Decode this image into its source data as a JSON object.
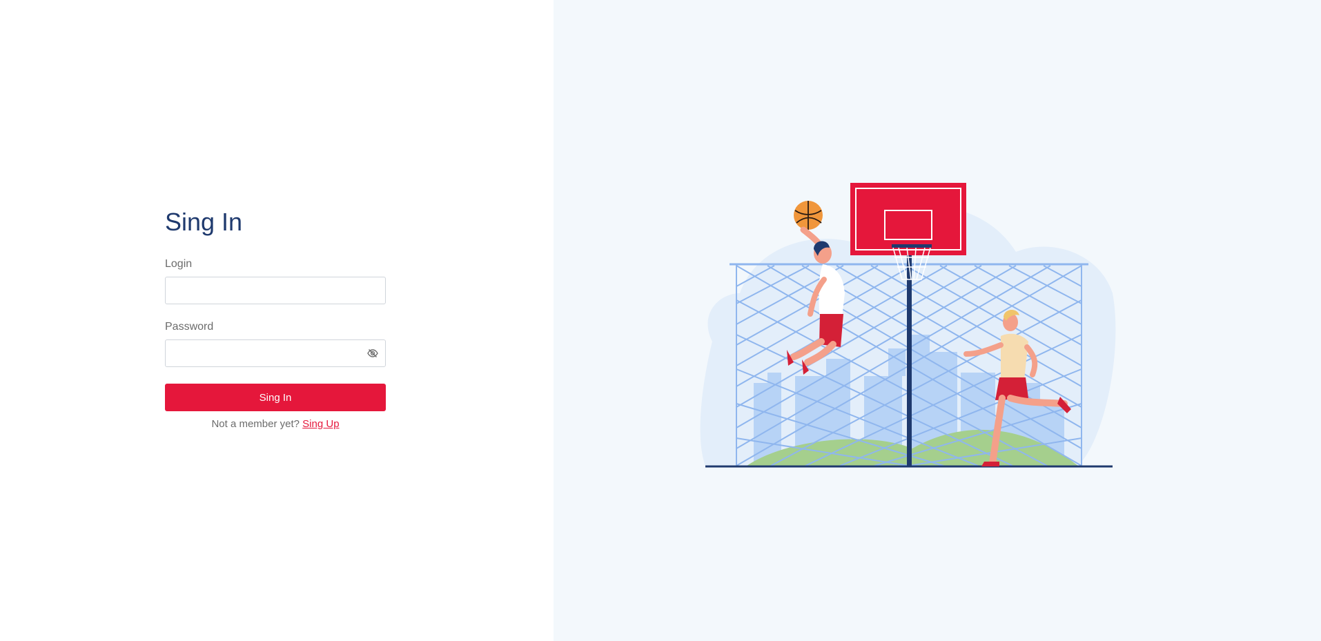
{
  "form": {
    "title": "Sing In",
    "login_label": "Login",
    "login_value": "",
    "password_label": "Password",
    "password_value": "",
    "submit_label": "Sing In",
    "signup_prompt": "Not a member yet?",
    "signup_link": "Sing Up"
  },
  "icons": {
    "password_toggle": "eye-slash-icon"
  },
  "colors": {
    "accent": "#e5173b",
    "title": "#1f3a6e",
    "right_panel_bg": "#f3f8fc"
  }
}
